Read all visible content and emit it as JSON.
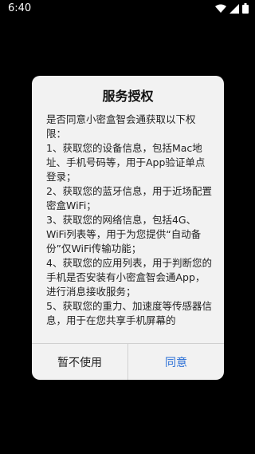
{
  "status_bar": {
    "time": "6:40",
    "icons": [
      "wifi-icon",
      "signal-icon",
      "battery-icon"
    ]
  },
  "dialog": {
    "title": "服务授权",
    "body": [
      "是否同意小密盒智会通获取以下权限：",
      "1、获取您的设备信息，包括Mac地址、手机号码等，用于App验证单点登录；",
      "2、获取您的蓝牙信息，用于近场配置密盒WiFi；",
      "3、获取您的网络信息，包括4G、WiFi列表等，用于为您提供“自动备份”仅WiFi传输功能；",
      "4、获取您的应用列表，用于判断您的手机是否安装有小密盒智会通App，进行消息接收服务；",
      "5、获取您的重力、加速度等传感器信息，用于在您共享手机屏幕的"
    ],
    "decline_label": "暂不使用",
    "agree_label": "同意"
  },
  "colors": {
    "background": "#000000",
    "dialog": "#f2f2f2",
    "agree_text": "#2a6fd6"
  }
}
